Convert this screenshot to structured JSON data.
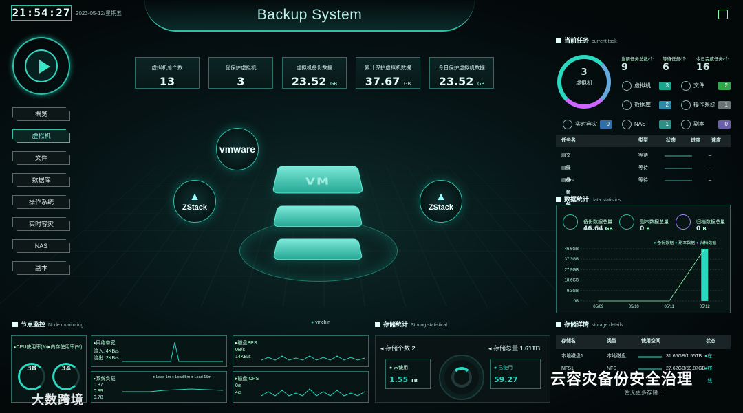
{
  "header": {
    "time": "21:54:27",
    "date": "2023-05-12/星期五",
    "title": "Backup System"
  },
  "nav": {
    "items": [
      "概览",
      "虚拟机",
      "文件",
      "数据库",
      "操作系统",
      "实时容灾",
      "NAS",
      "副本"
    ],
    "active": "虚拟机"
  },
  "kpis": [
    {
      "label": "虚拟机总个数",
      "value": "13",
      "unit": ""
    },
    {
      "label": "受保护虚拟机",
      "value": "3",
      "unit": ""
    },
    {
      "label": "虚拟机备份数据",
      "value": "23.52",
      "unit": "GB"
    },
    {
      "label": "累计保护虚拟机数据",
      "value": "37.67",
      "unit": "GB"
    },
    {
      "label": "今日保护虚拟机数据",
      "value": "23.52",
      "unit": "GB"
    }
  ],
  "center": {
    "vmware": "vmware",
    "zstack": "ZStack",
    "vm": "VM"
  },
  "current_task": {
    "title": "当前任务",
    "en": "current task",
    "ring_value": "3",
    "ring_label": "虚拟机",
    "stats": [
      {
        "label": "当前任务总数/个",
        "value": "9"
      },
      {
        "label": "等待任务/个",
        "value": "6"
      },
      {
        "label": "今日完成任务/个",
        "value": "16"
      }
    ],
    "tags": [
      {
        "name": "虚拟机",
        "count": "3",
        "color": "#1aa58f"
      },
      {
        "name": "文件",
        "count": "2",
        "color": "#2fa84a"
      },
      {
        "name": "数据库",
        "count": "2",
        "color": "#2f8aa8"
      },
      {
        "name": "操作系统",
        "count": "1",
        "color": "#6c7575"
      },
      {
        "name": "实时容灾",
        "count": "0",
        "color": "#2f6ea8"
      },
      {
        "name": "NAS",
        "count": "1",
        "color": "#2f8f86"
      },
      {
        "name": "副本",
        "count": "0",
        "color": "#6a5fa8"
      }
    ],
    "table": {
      "headers": [
        "任务名",
        "类型",
        "状态",
        "进度",
        "速度"
      ],
      "rows": [
        [
          "文件备份任务1",
          "等待",
          "",
          "–"
        ],
        [
          "操作系统备份任务1",
          "等待",
          "",
          "–"
        ],
        [
          "nas备份任务1",
          "等待",
          "",
          "–"
        ]
      ]
    }
  },
  "data_stats": {
    "title": "数据统计",
    "en": "data statistics",
    "items": [
      {
        "label": "备份数据总量",
        "value": "46.64",
        "unit": "GB"
      },
      {
        "label": "副本数据总量",
        "value": "0",
        "unit": "B"
      },
      {
        "label": "归档数据总量",
        "value": "0",
        "unit": "B"
      }
    ],
    "legend": [
      "备份数据",
      "副本数据",
      "归档数据"
    ]
  },
  "chart_data": {
    "type": "bar",
    "categories": [
      "05/09",
      "05/10",
      "05/11",
      "05/12"
    ],
    "yticks": [
      "46.6GB",
      "37.3GB",
      "27.9GB",
      "18.6GB",
      "9.3GB",
      "0B"
    ],
    "series": [
      {
        "name": "备份数据",
        "values": [
          0,
          0,
          0,
          46.6
        ]
      }
    ],
    "ylim": [
      0,
      46.6
    ]
  },
  "node": {
    "title": "节点监控",
    "en": "Node monitoring",
    "host": "vinchin",
    "cpu_label": "CPU使用率(%)",
    "mem_label": "内存使用率(%)",
    "cpu": "38",
    "mem": "34",
    "net": {
      "title": "网络带宽",
      "in_label": "流入:",
      "in": "4KB/s",
      "out_label": "流出:",
      "out": "2KB/s"
    },
    "load": {
      "title": "系统负载",
      "v1": "0.87",
      "v2": "0.89",
      "v3": "0.78",
      "legend": [
        "Load 1m",
        "Load 5m",
        "Load 15m"
      ]
    },
    "disk_bps": {
      "title": "磁盘BPS",
      "r": "0B/s",
      "w": "14KB/s"
    },
    "disk_iops": {
      "title": "磁盘IOPS",
      "r": "0/s",
      "w": "4/s"
    }
  },
  "storage": {
    "title": "存储统计",
    "en": "Storing statistical",
    "count_label": "存储个数",
    "count": "2",
    "total_label": "存储总量",
    "total": "1.61TB",
    "unused_label": "未使用",
    "unused": "1.55",
    "unused_unit": "TB",
    "used_label": "已使用",
    "used": "59.27"
  },
  "storage_detail": {
    "title": "存储详情",
    "en": "storage details",
    "headers": [
      "存储名",
      "类型",
      "使用空间",
      "状态"
    ],
    "rows": [
      [
        "本地磁盘1",
        "本地磁盘",
        "31.65GB/1.55TB",
        "在线"
      ],
      [
        "NFS1",
        "NFS",
        "27.62GB/59.87GB",
        "在线"
      ]
    ],
    "empty": "暂无更多存储..."
  },
  "watermark": {
    "left": "大数跨境",
    "right": "云容灾备份安全治理"
  }
}
